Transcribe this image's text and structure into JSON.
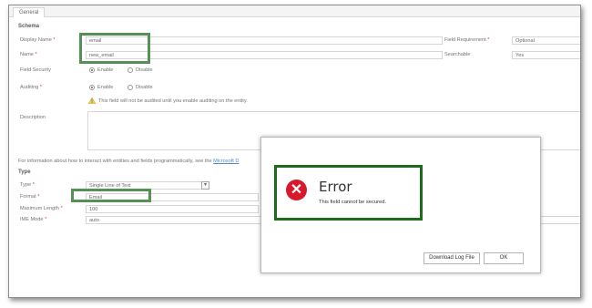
{
  "tabs": {
    "general": "General"
  },
  "schema": {
    "section_title": "Schema",
    "display_name_label": "Display Name",
    "display_name_value": "email",
    "name_label": "Name",
    "name_value": "new_email",
    "field_requirement_label": "Field Requirement",
    "field_requirement_value": "Optional",
    "searchable_label": "Searchable",
    "searchable_value": "Yes",
    "field_security_label": "Field Security",
    "field_security_enable": "Enable",
    "field_security_disable": "Disable",
    "auditing_label": "Auditing",
    "auditing_enable": "Enable",
    "auditing_disable": "Disable",
    "auditing_warning": "This field will not be audited until you enable auditing on the entity.",
    "description_label": "Description",
    "required_marker": "*"
  },
  "info": {
    "text": "For information about how to interact with entities and fields programmatically, see the",
    "link": "Microsoft D"
  },
  "type_section": {
    "section_title": "Type",
    "type_label": "Type",
    "type_value": "Single Line of Text",
    "format_label": "Format",
    "format_value": "Email",
    "max_length_label": "Maximum Length",
    "max_length_value": "100",
    "ime_mode_label": "IME Mode",
    "ime_mode_value": "auto"
  },
  "dialog": {
    "title": "Error",
    "message": "This field cannot be secured.",
    "download_button": "Download Log File",
    "ok_button": "OK",
    "icon": "error-x-icon",
    "icon_glyph": "✕"
  },
  "colors": {
    "highlight": "#1e6b1e",
    "error_red": "#d7192b",
    "required_red": "#c00000",
    "link_blue": "#1a5fb4"
  }
}
